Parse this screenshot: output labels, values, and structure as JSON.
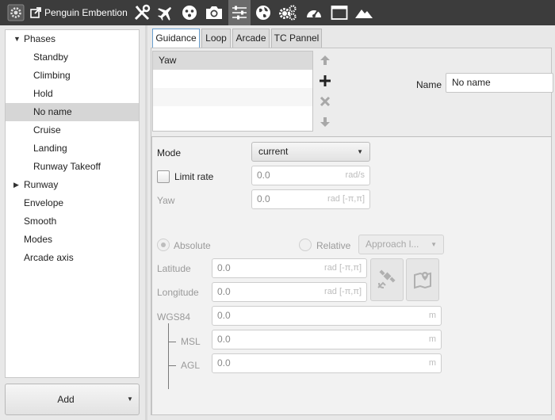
{
  "app": {
    "title": "Penguin Embention"
  },
  "toolbar": {
    "icons": [
      "gear-icon",
      "popout-icon",
      "tools-icon",
      "airplane-icon",
      "face-icon",
      "camera-icon",
      "sliders-icon",
      "globe-icon",
      "gears-icon",
      "gauge-icon",
      "window-icon",
      "mountain-icon"
    ],
    "active_icon": "sliders-icon"
  },
  "tree": {
    "items": [
      {
        "label": "Phases",
        "expanded": true,
        "level": 0
      },
      {
        "label": "Standby",
        "level": 1
      },
      {
        "label": "Climbing",
        "level": 1
      },
      {
        "label": "Hold",
        "level": 1
      },
      {
        "label": "No name",
        "level": 1,
        "selected": true
      },
      {
        "label": "Cruise",
        "level": 1
      },
      {
        "label": "Landing",
        "level": 1
      },
      {
        "label": "Runway Takeoff",
        "level": 1
      },
      {
        "label": "Runway",
        "expanded": false,
        "level": 0
      },
      {
        "label": "Envelope",
        "level": 0
      },
      {
        "label": "Smooth",
        "level": 0
      },
      {
        "label": "Modes",
        "level": 0
      },
      {
        "label": "Arcade axis",
        "level": 0
      }
    ],
    "add_label": "Add"
  },
  "tabs": [
    {
      "label": "Guidance",
      "active": true
    },
    {
      "label": "Loop"
    },
    {
      "label": "Arcade"
    },
    {
      "label": "TC Pannel"
    }
  ],
  "guidance": {
    "list": [
      "Yaw"
    ],
    "name_label": "Name",
    "name_value": "No name",
    "mode_label": "Mode",
    "mode_value": "current",
    "limit_rate_label": "Limit rate",
    "limit_rate_checked": false,
    "limit_rate_value": "0.0",
    "limit_rate_unit": "rad/s",
    "yaw_label": "Yaw",
    "yaw_value": "0.0",
    "yaw_unit": "rad [-π,π]",
    "absolute_label": "Absolute",
    "absolute_selected": true,
    "relative_label": "Relative",
    "relative_combo": "Approach l...",
    "latitude_label": "Latitude",
    "latitude_value": "0.0",
    "latitude_unit": "rad [-π,π]",
    "longitude_label": "Longitude",
    "longitude_value": "0.0",
    "longitude_unit": "rad [-π,π]",
    "wgs84_label": "WGS84",
    "wgs84_value": "0.0",
    "wgs84_unit": "m",
    "msl_label": "MSL",
    "msl_value": "0.0",
    "msl_unit": "m",
    "agl_label": "AGL",
    "agl_value": "0.0",
    "agl_unit": "m"
  },
  "colors": {
    "toolbar_bg": "#3c3c3c",
    "selection": "#d6d6d6",
    "tab_active_border": "#6a9fcf",
    "add_icon": "#222222",
    "disabled_icon": "#a8a8a8"
  }
}
